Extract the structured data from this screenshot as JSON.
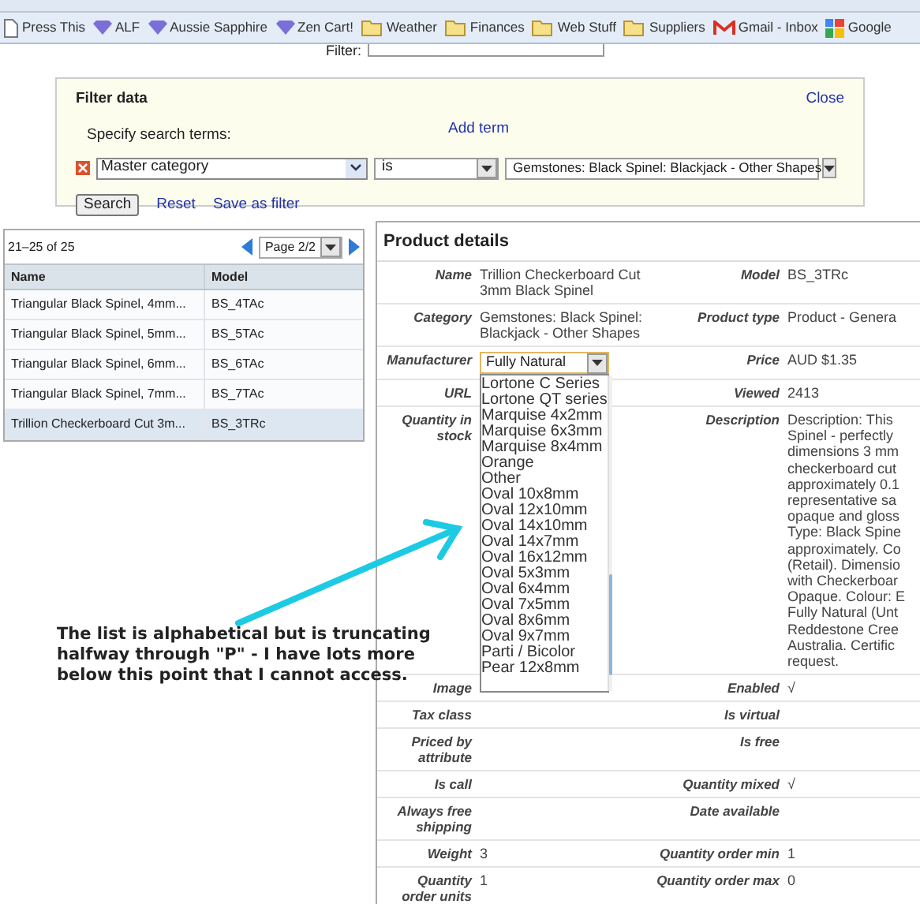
{
  "bookmarks": [
    {
      "label": "Press This",
      "kind": "page"
    },
    {
      "label": "ALF",
      "kind": "gem"
    },
    {
      "label": "Aussie Sapphire",
      "kind": "gem"
    },
    {
      "label": "Zen Cart!",
      "kind": "gem"
    },
    {
      "label": "Weather",
      "kind": "folder"
    },
    {
      "label": "Finances",
      "kind": "folder"
    },
    {
      "label": "Web Stuff",
      "kind": "folder"
    },
    {
      "label": "Suppliers",
      "kind": "folder"
    },
    {
      "label": "Gmail - Inbox",
      "kind": "mail"
    },
    {
      "label": "Google",
      "kind": "google"
    }
  ],
  "toolbar": {
    "filter_label": "Filter:"
  },
  "filter_panel": {
    "title": "Filter data",
    "close": "Close",
    "prompt": "Specify search terms:",
    "add_term": "Add term",
    "term": {
      "field": "Master category",
      "operator": "is",
      "value": "Gemstones: Black Spinel: Blackjack - Other Shapes"
    },
    "search": "Search",
    "reset": "Reset",
    "save": "Save as filter"
  },
  "grid": {
    "range": "21–25 of 25",
    "page": "Page 2/2",
    "columns": [
      "Name",
      "Model"
    ],
    "rows": [
      {
        "name": "Triangular Black Spinel, 4mm...",
        "model": "BS_4TAc",
        "selected": false
      },
      {
        "name": "Triangular Black Spinel, 5mm...",
        "model": "BS_5TAc",
        "selected": false
      },
      {
        "name": "Triangular Black Spinel, 6mm...",
        "model": "BS_6TAc",
        "selected": false
      },
      {
        "name": "Triangular Black Spinel, 7mm...",
        "model": "BS_7TAc",
        "selected": false
      },
      {
        "name": "Trillion Checkerboard Cut 3m...",
        "model": "BS_3TRc",
        "selected": true
      }
    ]
  },
  "details": {
    "title": "Product details",
    "check_mark": "√",
    "rows": [
      {
        "left": {
          "label": "Name",
          "kind": "text",
          "value": "Trillion Checkerboard Cut 3mm Black Spinel"
        },
        "right": {
          "label": "Model",
          "kind": "text",
          "value": "BS_3TRc"
        }
      },
      {
        "left": {
          "label": "Category",
          "kind": "text",
          "value": "Gemstones: Black Spinel: Blackjack - Other Shapes"
        },
        "right": {
          "label": "Product type",
          "kind": "text",
          "value": "Product - Genera"
        }
      },
      {
        "left": {
          "label": "Manufacturer",
          "kind": "select",
          "value": "Fully Natural",
          "expanded": true,
          "options": [
            "Lortone C Series",
            "Lortone QT series",
            "Marquise 4x2mm",
            "Marquise 6x3mm",
            "Marquise 8x4mm",
            "Orange",
            "Other",
            "Oval 10x8mm",
            "Oval 12x10mm",
            "Oval 14x10mm",
            "Oval 14x7mm",
            "Oval 16x12mm",
            "Oval 5x3mm",
            "Oval 6x4mm",
            "Oval 7x5mm",
            "Oval 8x6mm",
            "Oval 9x7mm",
            "Parti / Bicolor",
            "Pear 12x8mm"
          ]
        },
        "right": {
          "label": "Price",
          "kind": "text",
          "value": "AUD $1.35"
        }
      },
      {
        "left": {
          "label": "URL",
          "kind": "empty"
        },
        "right": {
          "label": "Viewed",
          "kind": "text",
          "value": "2413"
        }
      },
      {
        "left": {
          "label": "Quantity in stock",
          "kind": "empty"
        },
        "right": {
          "label": "Description",
          "kind": "lines",
          "lines": [
            "Description: This",
            "Spinel - perfectly",
            "dimensions 3 mm",
            "checkerboard cut",
            "approximately 0.1",
            "representative sa",
            "opaque and gloss",
            "Type: Black Spine",
            "approximately. Co",
            "(Retail). Dimensio",
            "with Checkerboar",
            "Opaque. Colour: E",
            "Fully Natural (Unt",
            "Reddestone Cree",
            "Australia. Certific",
            "request."
          ]
        }
      },
      {
        "left": {
          "label": "Image",
          "kind": "empty"
        },
        "right": {
          "label": "Enabled",
          "kind": "check",
          "checked": true
        }
      },
      {
        "left": {
          "label": "Tax class",
          "kind": "empty"
        },
        "right": {
          "label": "Is virtual",
          "kind": "check",
          "checked": false
        }
      },
      {
        "left": {
          "label": "Priced by attribute",
          "kind": "empty"
        },
        "right": {
          "label": "Is free",
          "kind": "check",
          "checked": false
        }
      },
      {
        "left": {
          "label": "Is call",
          "kind": "empty"
        },
        "right": {
          "label": "Quantity mixed",
          "kind": "check",
          "checked": true
        }
      },
      {
        "left": {
          "label": "Always free shipping",
          "kind": "empty"
        },
        "right": {
          "label": "Date available",
          "kind": "empty"
        }
      },
      {
        "left": {
          "label": "Weight",
          "kind": "text",
          "value": "3"
        },
        "right": {
          "label": "Quantity order min",
          "kind": "text",
          "value": "1"
        }
      },
      {
        "left": {
          "label": "Quantity order units",
          "kind": "text",
          "value": "1"
        },
        "right": {
          "label": "Quantity order max",
          "kind": "text",
          "value": "0"
        }
      }
    ]
  },
  "annotation": {
    "text": "The list is alphabetical but is truncating halfway through \"P\" - I have lots more below this point that I cannot access."
  }
}
